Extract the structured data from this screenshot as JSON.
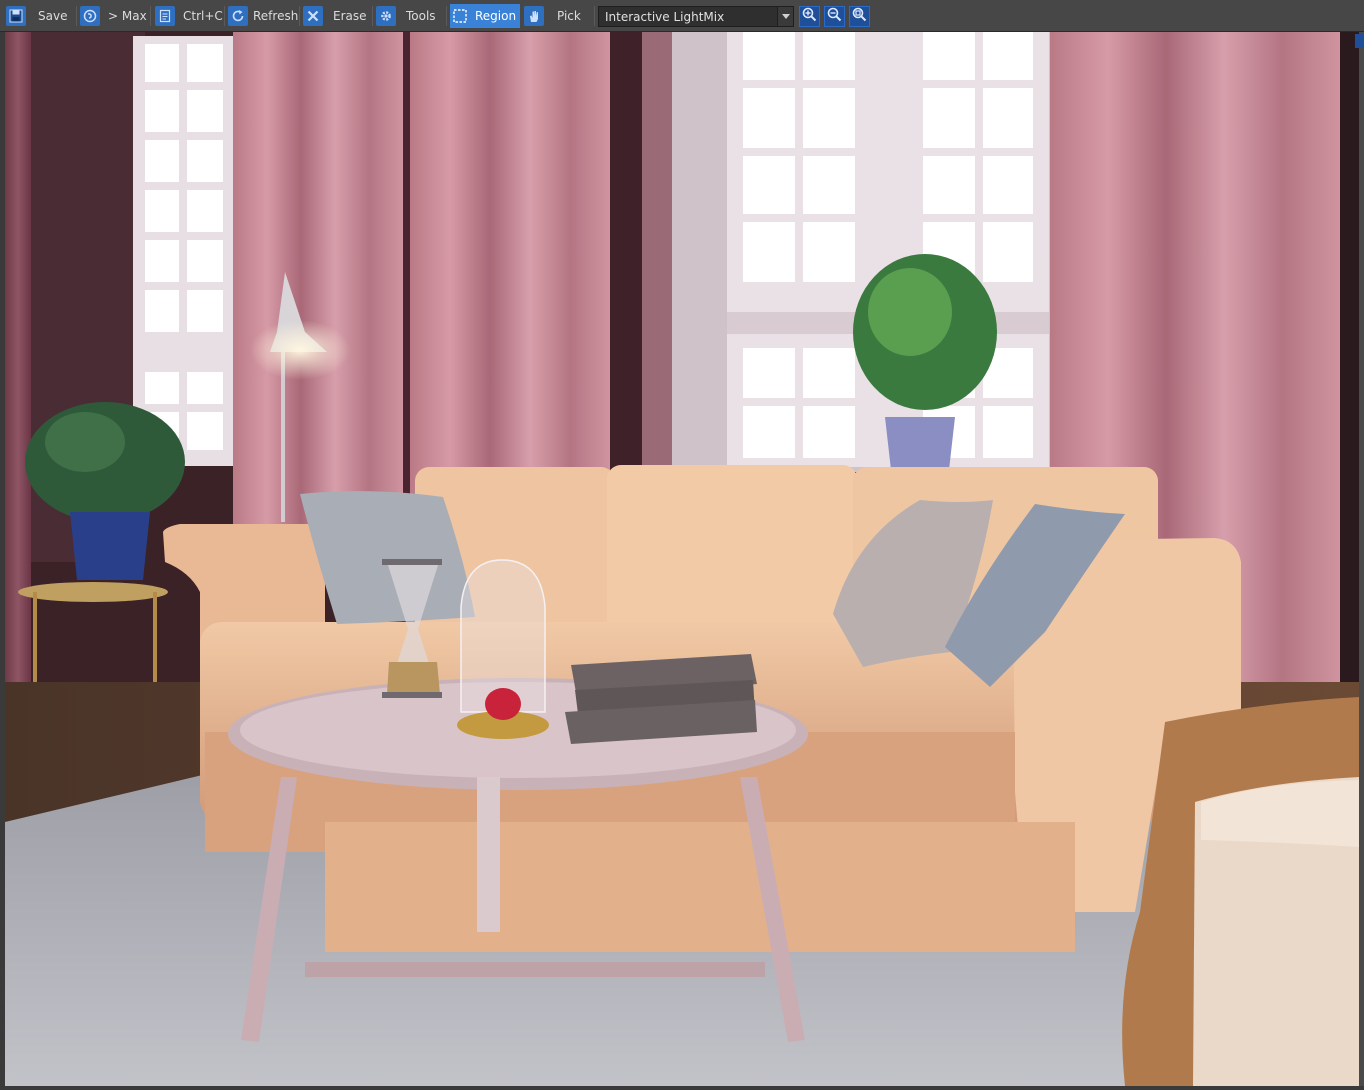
{
  "toolbar": {
    "save_label": "Save",
    "to_max_label": "> Max",
    "copy_label": "Ctrl+C",
    "refresh_label": "Refresh",
    "erase_label": "Erase",
    "tools_label": "Tools",
    "region_label": "Region",
    "pick_label": "Pick",
    "mode_dropdown": {
      "selected": "Interactive LightMix"
    }
  },
  "icons": {
    "save": "save-icon",
    "to_max": "send-to-max-icon",
    "copy": "clipboard-icon",
    "refresh": "refresh-icon",
    "erase": "erase-icon",
    "tools": "gear-icon",
    "region": "region-select-icon",
    "pick": "hand-pick-icon",
    "zoom_in": "zoom-in-icon",
    "zoom_out": "zoom-out-icon",
    "zoom_fit": "zoom-fit-icon"
  },
  "colors": {
    "toolbar_bg": "#474747",
    "accent": "#3a82d8",
    "viewport_bg": "#2b1d1f"
  }
}
